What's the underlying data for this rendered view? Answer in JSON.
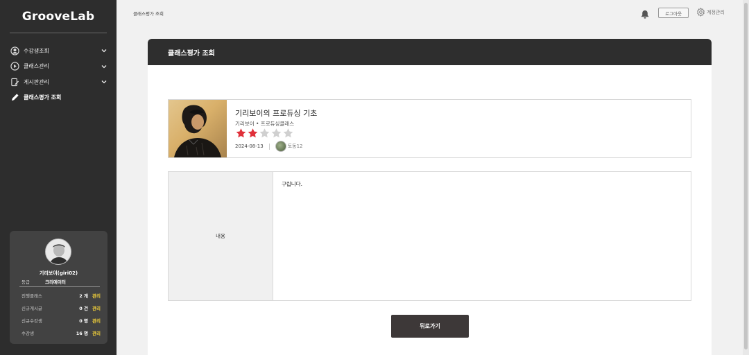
{
  "app": {
    "logo": "GrooveLab"
  },
  "sidebar": {
    "items": [
      {
        "label": "수강생조회",
        "icon": "user-circle-icon",
        "expandable": true
      },
      {
        "label": "클래스관리",
        "icon": "play-circle-icon",
        "expandable": true
      },
      {
        "label": "게시판관리",
        "icon": "edit-document-icon",
        "expandable": true
      },
      {
        "label": "클래스평가 조회",
        "icon": "pencil-icon",
        "expandable": false,
        "active": true
      }
    ],
    "profile": {
      "name": "기리보이(giri02)",
      "grade_label": "등급",
      "grade_value": "크리에이터",
      "stats": [
        {
          "label": "진행클래스",
          "value": "2 개",
          "link": "관리"
        },
        {
          "label": "신규게시글",
          "value": "0 건",
          "link": "관리"
        },
        {
          "label": "신규수강생",
          "value": "0 명",
          "link": "관리"
        },
        {
          "label": "수강생",
          "value": "16 명",
          "link": "관리"
        }
      ]
    }
  },
  "topbar": {
    "breadcrumb": "클래스평가 조회",
    "logout_label": "로그아웃",
    "account_label": "계정관리"
  },
  "panel": {
    "title": "클래스평가 조회",
    "review": {
      "class_title": "기리보이의 프로듀싱 기초",
      "class_subtitle": "기리보이 • 프로듀싱클래스",
      "rating": 2,
      "rating_max": 5,
      "date": "2024-08-13",
      "reviewer": "토동12",
      "content_label": "내용",
      "content_text": "구립니다."
    },
    "back_label": "뒤로가기"
  },
  "colors": {
    "sidebar_bg": "#2d2d2d",
    "panel_header_bg": "#2e2e2e",
    "star_filled": "#e0303a",
    "star_empty": "#d0d0d0",
    "link_accent": "#f5d33a",
    "back_button_bg": "#3d3838"
  }
}
